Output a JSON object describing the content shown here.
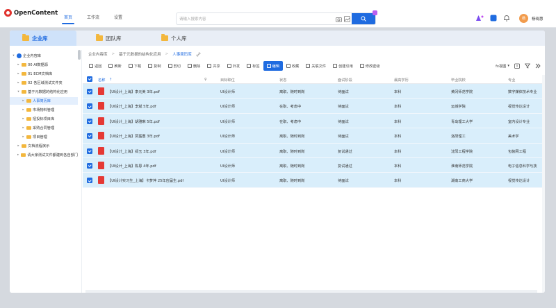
{
  "app": {
    "brand": "OpenContent"
  },
  "nav": {
    "items": [
      "首页",
      "工作流",
      "设置"
    ]
  },
  "search": {
    "placeholder": "请输入搜索内容"
  },
  "user": {
    "avatar": "杨",
    "name": "杨晓惠"
  },
  "tabs": [
    "企业库",
    "团队库",
    "个人库"
  ],
  "tree": [
    {
      "label": "企业内容库",
      "indent": 0,
      "caret": "▾",
      "type": "root"
    },
    {
      "label": "00 AI数据源",
      "indent": 1,
      "caret": "▸",
      "type": "folder"
    },
    {
      "label": "01 ECM文档库",
      "indent": 1,
      "caret": "▸",
      "type": "folder"
    },
    {
      "label": "02 各区域测试文件夹",
      "indent": 1,
      "caret": "▸",
      "type": "folder"
    },
    {
      "label": "基于元数据的结构化应用",
      "indent": 1,
      "caret": "▾",
      "type": "folder"
    },
    {
      "label": "人事简历库",
      "indent": 2,
      "caret": "▸",
      "type": "folder",
      "selected": true
    },
    {
      "label": "市场物料管理",
      "indent": 2,
      "caret": "▸",
      "type": "folder"
    },
    {
      "label": "招投标项目库",
      "indent": 2,
      "caret": "▸",
      "type": "folder"
    },
    {
      "label": "采购合同管理",
      "indent": 2,
      "caret": "▸",
      "type": "folder"
    },
    {
      "label": "项目管理",
      "indent": 2,
      "caret": "▸",
      "type": "folder"
    },
    {
      "label": "文档流程演示",
      "indent": 1,
      "caret": "▸",
      "type": "folder"
    },
    {
      "label": "请大家测试文件都建到各自部门",
      "indent": 1,
      "caret": "▸",
      "type": "folder"
    }
  ],
  "breadcrumb": [
    "企业内容库",
    "基于元数据的结构化应用",
    "人事简历库"
  ],
  "toolbar": [
    {
      "label": "返回",
      "icon": "back-icon"
    },
    {
      "label": "刷新",
      "icon": "refresh-icon"
    },
    {
      "label": "下载",
      "icon": "download-icon"
    },
    {
      "label": "复制",
      "icon": "copy-icon"
    },
    {
      "label": "剪切",
      "icon": "cut-icon"
    },
    {
      "label": "删除",
      "icon": "delete-icon"
    },
    {
      "label": "共享",
      "icon": "share-icon"
    },
    {
      "label": "外发",
      "icon": "send-icon"
    },
    {
      "label": "标签",
      "icon": "tag-icon"
    },
    {
      "label": "编辑",
      "icon": "edit-icon",
      "primary": true
    },
    {
      "label": "收藏",
      "icon": "star-icon"
    },
    {
      "label": "关联文件",
      "icon": "link-icon"
    },
    {
      "label": "创建引用",
      "icon": "reference-icon"
    },
    {
      "label": "修改密级",
      "icon": "lock-icon"
    }
  ],
  "view": {
    "label": "fx视图"
  },
  "table": {
    "headers": [
      "名称",
      "目标职位",
      "状态",
      "面试阶段",
      "最高学历",
      "毕业院校",
      "专业"
    ],
    "rows": [
      [
        "【UI设计_上海】李元美 3年.pdf",
        "UI设计师",
        "离职、随时到岗",
        "待面试",
        "本科",
        "黄冈师范学院",
        "数字媒体技术专业"
      ],
      [
        "【UI设计_上海】李斌 5年.pdf",
        "UI设计师",
        "在职、考虑中",
        "待面试",
        "本科",
        "运城学院",
        "视觉传达设计"
      ],
      [
        "【UI设计_上海】胡雅琳 5年.pdf",
        "UI设计师",
        "在职、考虑中",
        "待面试",
        "本科",
        "青岛理工大学",
        "室内设计专业"
      ],
      [
        "【UI设计_上海】贾露惠 3年.pdf",
        "UI设计师",
        "离职、随时到岗",
        "待面试",
        "本科",
        "洛阳理工",
        "美术学"
      ],
      [
        "【UI设计_上海】郑玉 3年.pdf",
        "UI设计师",
        "离职、随时到岗",
        "复试通过",
        "本科",
        "沈阳工程学院",
        "包装网工程"
      ],
      [
        "【UI设计_上海】陈恩 4年.pdf",
        "UI设计师",
        "离职、随时到岗",
        "复试通过",
        "本科",
        "淮南师范学院",
        "电子信息科学与技"
      ],
      [
        "【UI设计实习生_上海】卡梦萍 25年应届生.pdf",
        "UI设计师",
        "离职、随时到岗",
        "待面试",
        "本科",
        "湖南工商大学",
        "视觉传达设计"
      ]
    ]
  }
}
